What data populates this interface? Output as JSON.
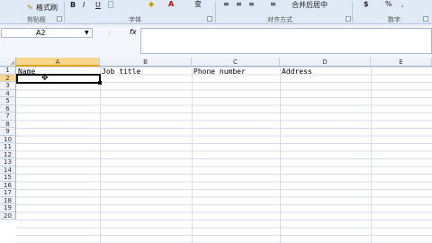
{
  "ribbon": {
    "format_painter_label": "格式刷",
    "bold_label": "B",
    "italic_label": "I",
    "underline_label": "U",
    "font_color_label": "A",
    "wen_label": "变",
    "wrap_label": "≡",
    "merge_label": "合并后居中",
    "currency_label": "$",
    "percent_label": "%",
    "groups": {
      "clipboard": "剪贴板",
      "font": "字体",
      "alignment": "对齐方式",
      "number": "数字"
    }
  },
  "formula_bar": {
    "name_box": "A2",
    "fx_label": "fx",
    "formula": ""
  },
  "columns": [
    "A",
    "B",
    "C",
    "D",
    "E"
  ],
  "rows": [
    "1",
    "2",
    "3",
    "4",
    "5",
    "6",
    "7",
    "8",
    "9",
    "10",
    "11",
    "12",
    "13",
    "14",
    "15",
    "16",
    "17",
    "18",
    "19",
    "20"
  ],
  "cells": {
    "A1": "Name",
    "B1": "Job title",
    "C1": "Phone number",
    "D1": "Address"
  },
  "selected_cell": "A2",
  "colors": {
    "ribbon_bg": "#dfe8f5",
    "header_bg": "#eef2f8",
    "selected_header": "#f8d68d",
    "gridline": "#d7dde6"
  }
}
